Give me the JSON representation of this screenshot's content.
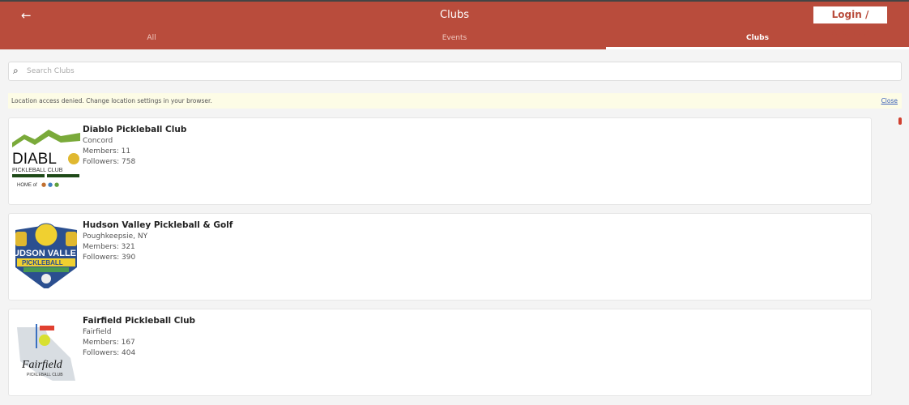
{
  "header": {
    "title": "Clubs",
    "login_label": "Login / Signup",
    "back_icon": "arrow-left-icon"
  },
  "tabs": [
    {
      "label": "All"
    },
    {
      "label": "Events"
    },
    {
      "label": "Clubs",
      "active": true
    }
  ],
  "search": {
    "placeholder": "Search Clubs",
    "value": ""
  },
  "banner": {
    "message": "Location access denied. Change location settings in your browser.",
    "close_label": "Close"
  },
  "clubs": [
    {
      "name": "Diablo Pickleball Club",
      "location": "Concord",
      "members": "Members: 11",
      "followers": "Followers: 758",
      "logo_text": "DIABLO PICKLEBALL CLUB"
    },
    {
      "name": "Hudson Valley Pickleball & Golf",
      "location": "Poughkeepsie, NY",
      "members": "Members: 321",
      "followers": "Followers: 390",
      "logo_text": "HUDSON VALLEY PICKLEBALL & GOLF CENTER"
    },
    {
      "name": "Fairfield Pickleball Club",
      "location": "Fairfield",
      "members": "Members: 167",
      "followers": "Followers: 404",
      "logo_text": "Fairfield PICKLEBALL CLUB"
    }
  ],
  "colors": {
    "brand": "#b94c3c",
    "banner": "#fdfce6"
  }
}
